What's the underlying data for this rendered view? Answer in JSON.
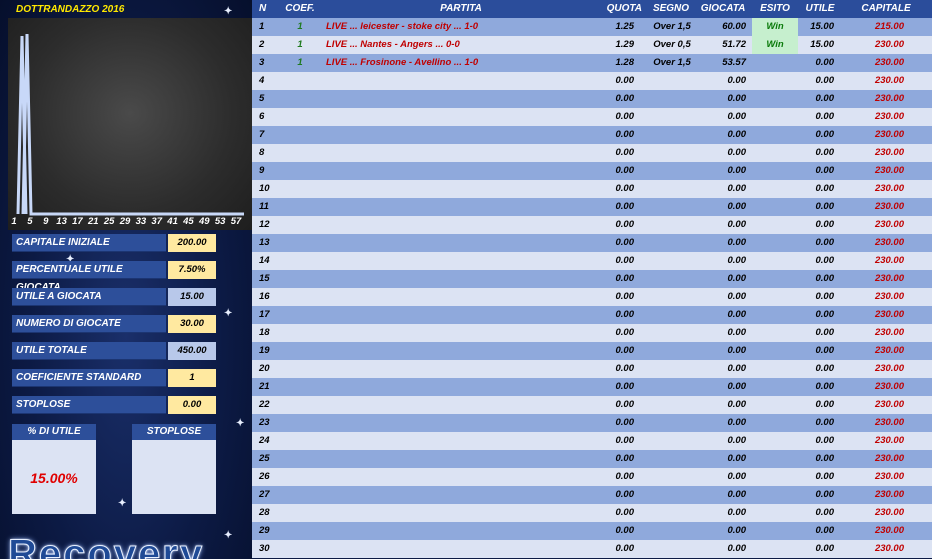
{
  "left_panel": {
    "title": "DOTTRANDAZZO 2016",
    "fields": [
      {
        "label": "CAPITALE INIZIALE",
        "value": "200.00",
        "style": "yellow"
      },
      {
        "label": "PERCENTUALE UTILE GIOCATA",
        "value": "7.50%",
        "style": "yellow"
      },
      {
        "label": "UTILE A GIOCATA",
        "value": "15.00",
        "style": "blue"
      },
      {
        "label": "NUMERO DI GIOCATE",
        "value": "30.00",
        "style": "yellow"
      },
      {
        "label": "UTILE TOTALE",
        "value": "450.00",
        "style": "blue"
      },
      {
        "label": "COEFICIENTE STANDARD",
        "value": "1",
        "style": "yellow"
      },
      {
        "label": "STOPLOSE",
        "value": "0.00",
        "style": "yellow"
      }
    ],
    "box_utile": {
      "header": "% DI UTILE",
      "value": "15.00%"
    },
    "box_stoplose": {
      "header": "STOPLOSE"
    },
    "banner": "Recovery"
  },
  "chart_data": {
    "type": "line",
    "x_tick_labels": [
      "1",
      "5",
      "9",
      "13",
      "17",
      "21",
      "25",
      "29",
      "33",
      "37",
      "41",
      "45",
      "49",
      "53",
      "57"
    ]
  },
  "table": {
    "headers": {
      "n": "N",
      "coef": "COEF.",
      "partita": "PARTITA",
      "quota": "QUOTA",
      "segno": "SEGNO",
      "giocata": "GIOCATA",
      "esito": "ESITO",
      "utile": "UTILE",
      "capitale": "CAPITALE"
    },
    "rows": [
      {
        "n": "1",
        "coef": "1",
        "partita": "LIVE ... leicester - stoke city ... 1-0",
        "quota": "1.25",
        "segno": "Over 1,5",
        "giocata": "60.00",
        "esito": "Win",
        "utile": "15.00",
        "capitale": "215.00"
      },
      {
        "n": "2",
        "coef": "1",
        "partita": "LIVE ... Nantes - Angers ... 0-0",
        "quota": "1.29",
        "segno": "Over 0,5",
        "giocata": "51.72",
        "esito": "Win",
        "utile": "15.00",
        "capitale": "230.00"
      },
      {
        "n": "3",
        "coef": "1",
        "partita": "LIVE ... Frosinone - Avellino ... 1-0",
        "quota": "1.28",
        "segno": "Over 1,5",
        "giocata": "53.57",
        "esito": "",
        "utile": "0.00",
        "capitale": "230.00"
      },
      {
        "n": "4",
        "coef": "",
        "partita": "",
        "quota": "0.00",
        "segno": "",
        "giocata": "0.00",
        "esito": "",
        "utile": "0.00",
        "capitale": "230.00"
      },
      {
        "n": "5",
        "coef": "",
        "partita": "",
        "quota": "0.00",
        "segno": "",
        "giocata": "0.00",
        "esito": "",
        "utile": "0.00",
        "capitale": "230.00"
      },
      {
        "n": "6",
        "coef": "",
        "partita": "",
        "quota": "0.00",
        "segno": "",
        "giocata": "0.00",
        "esito": "",
        "utile": "0.00",
        "capitale": "230.00"
      },
      {
        "n": "7",
        "coef": "",
        "partita": "",
        "quota": "0.00",
        "segno": "",
        "giocata": "0.00",
        "esito": "",
        "utile": "0.00",
        "capitale": "230.00"
      },
      {
        "n": "8",
        "coef": "",
        "partita": "",
        "quota": "0.00",
        "segno": "",
        "giocata": "0.00",
        "esito": "",
        "utile": "0.00",
        "capitale": "230.00"
      },
      {
        "n": "9",
        "coef": "",
        "partita": "",
        "quota": "0.00",
        "segno": "",
        "giocata": "0.00",
        "esito": "",
        "utile": "0.00",
        "capitale": "230.00"
      },
      {
        "n": "10",
        "coef": "",
        "partita": "",
        "quota": "0.00",
        "segno": "",
        "giocata": "0.00",
        "esito": "",
        "utile": "0.00",
        "capitale": "230.00"
      },
      {
        "n": "11",
        "coef": "",
        "partita": "",
        "quota": "0.00",
        "segno": "",
        "giocata": "0.00",
        "esito": "",
        "utile": "0.00",
        "capitale": "230.00"
      },
      {
        "n": "12",
        "coef": "",
        "partita": "",
        "quota": "0.00",
        "segno": "",
        "giocata": "0.00",
        "esito": "",
        "utile": "0.00",
        "capitale": "230.00"
      },
      {
        "n": "13",
        "coef": "",
        "partita": "",
        "quota": "0.00",
        "segno": "",
        "giocata": "0.00",
        "esito": "",
        "utile": "0.00",
        "capitale": "230.00"
      },
      {
        "n": "14",
        "coef": "",
        "partita": "",
        "quota": "0.00",
        "segno": "",
        "giocata": "0.00",
        "esito": "",
        "utile": "0.00",
        "capitale": "230.00"
      },
      {
        "n": "15",
        "coef": "",
        "partita": "",
        "quota": "0.00",
        "segno": "",
        "giocata": "0.00",
        "esito": "",
        "utile": "0.00",
        "capitale": "230.00"
      },
      {
        "n": "16",
        "coef": "",
        "partita": "",
        "quota": "0.00",
        "segno": "",
        "giocata": "0.00",
        "esito": "",
        "utile": "0.00",
        "capitale": "230.00"
      },
      {
        "n": "17",
        "coef": "",
        "partita": "",
        "quota": "0.00",
        "segno": "",
        "giocata": "0.00",
        "esito": "",
        "utile": "0.00",
        "capitale": "230.00"
      },
      {
        "n": "18",
        "coef": "",
        "partita": "",
        "quota": "0.00",
        "segno": "",
        "giocata": "0.00",
        "esito": "",
        "utile": "0.00",
        "capitale": "230.00"
      },
      {
        "n": "19",
        "coef": "",
        "partita": "",
        "quota": "0.00",
        "segno": "",
        "giocata": "0.00",
        "esito": "",
        "utile": "0.00",
        "capitale": "230.00"
      },
      {
        "n": "20",
        "coef": "",
        "partita": "",
        "quota": "0.00",
        "segno": "",
        "giocata": "0.00",
        "esito": "",
        "utile": "0.00",
        "capitale": "230.00"
      },
      {
        "n": "21",
        "coef": "",
        "partita": "",
        "quota": "0.00",
        "segno": "",
        "giocata": "0.00",
        "esito": "",
        "utile": "0.00",
        "capitale": "230.00"
      },
      {
        "n": "22",
        "coef": "",
        "partita": "",
        "quota": "0.00",
        "segno": "",
        "giocata": "0.00",
        "esito": "",
        "utile": "0.00",
        "capitale": "230.00"
      },
      {
        "n": "23",
        "coef": "",
        "partita": "",
        "quota": "0.00",
        "segno": "",
        "giocata": "0.00",
        "esito": "",
        "utile": "0.00",
        "capitale": "230.00"
      },
      {
        "n": "24",
        "coef": "",
        "partita": "",
        "quota": "0.00",
        "segno": "",
        "giocata": "0.00",
        "esito": "",
        "utile": "0.00",
        "capitale": "230.00"
      },
      {
        "n": "25",
        "coef": "",
        "partita": "",
        "quota": "0.00",
        "segno": "",
        "giocata": "0.00",
        "esito": "",
        "utile": "0.00",
        "capitale": "230.00"
      },
      {
        "n": "26",
        "coef": "",
        "partita": "",
        "quota": "0.00",
        "segno": "",
        "giocata": "0.00",
        "esito": "",
        "utile": "0.00",
        "capitale": "230.00"
      },
      {
        "n": "27",
        "coef": "",
        "partita": "",
        "quota": "0.00",
        "segno": "",
        "giocata": "0.00",
        "esito": "",
        "utile": "0.00",
        "capitale": "230.00"
      },
      {
        "n": "28",
        "coef": "",
        "partita": "",
        "quota": "0.00",
        "segno": "",
        "giocata": "0.00",
        "esito": "",
        "utile": "0.00",
        "capitale": "230.00"
      },
      {
        "n": "29",
        "coef": "",
        "partita": "",
        "quota": "0.00",
        "segno": "",
        "giocata": "0.00",
        "esito": "",
        "utile": "0.00",
        "capitale": "230.00"
      },
      {
        "n": "30",
        "coef": "",
        "partita": "",
        "quota": "0.00",
        "segno": "",
        "giocata": "0.00",
        "esito": "",
        "utile": "0.00",
        "capitale": "230.00"
      }
    ]
  },
  "colors": {
    "header_blue": "#2b4d9b",
    "row_odd": "#8fa9dc",
    "row_even": "#dce3f3",
    "value_yellow": "#ffe9a0",
    "win_green": "#c6efce",
    "text_red": "#c00000"
  }
}
